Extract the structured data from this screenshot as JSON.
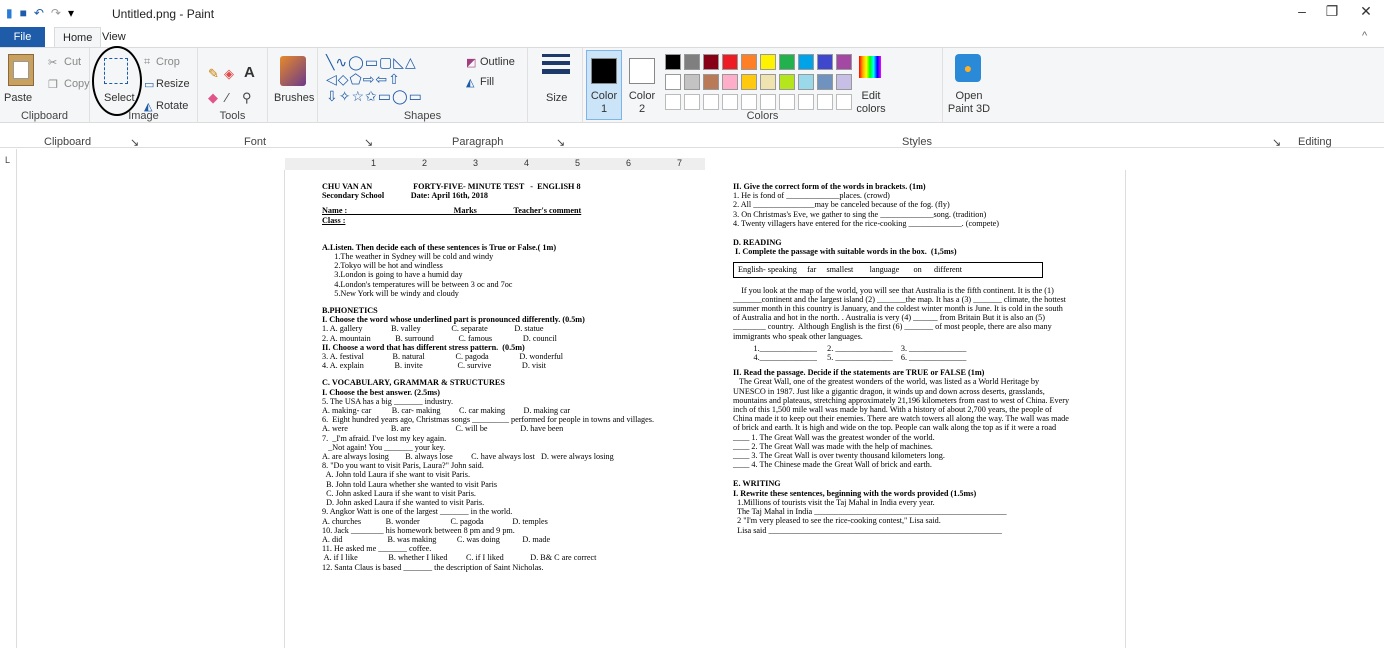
{
  "titlebar": {
    "title": "Untitled.png - Paint"
  },
  "tabs": {
    "file": "File",
    "home": "Home",
    "view": "View"
  },
  "clipboard": {
    "paste": "Paste",
    "cut": "Cut",
    "copy": "Copy",
    "label": "Clipboard"
  },
  "image": {
    "select": "Select",
    "crop": "Crop",
    "resize": "Resize",
    "rotate": "Rotate",
    "label": "Image"
  },
  "tools": {
    "label": "Tools"
  },
  "brushes": {
    "label": "Brushes"
  },
  "shapes": {
    "outline": "Outline",
    "fill": "Fill",
    "label": "Shapes"
  },
  "size": {
    "label": "Size"
  },
  "colors": {
    "color1": "Color\n1",
    "color2": "Color\n2",
    "edit": "Edit\ncolors",
    "label": "Colors",
    "palette_row1": [
      "#000000",
      "#7f7f7f",
      "#880015",
      "#ed1c24",
      "#ff7f27",
      "#fff200",
      "#22b14c",
      "#00a2e8",
      "#3f48cc",
      "#a349a4"
    ],
    "palette_row2": [
      "#ffffff",
      "#c3c3c3",
      "#b97a57",
      "#ffaec9",
      "#ffc90e",
      "#efe4b0",
      "#b5e61d",
      "#99d9ea",
      "#7092be",
      "#c8bfe7"
    ]
  },
  "paint3d": {
    "label": "Open\nPaint 3D"
  },
  "word_sections": {
    "clipboard": "Clipboard",
    "font": "Font",
    "paragraph": "Paragraph",
    "styles": "Styles",
    "editing": "Editing"
  },
  "ruler": {
    "marks": [
      "1",
      "2",
      "3",
      "4",
      "5",
      "6",
      "7"
    ]
  },
  "doc": {
    "left": [
      "CHU VAN AN                    FORTY-FIVE- MINUTE TEST   -  ENGLISH 8",
      "Secondary School             Date: April 16th, 2018",
      "Name :                                                    Marks                  Teacher's comment",
      "Class :",
      "A.Listen. Then decide each of these sentences is True or False.( 1m)",
      "      1.The weather in Sydney will be cold and windy",
      "      2.Tokyo will be hot and windless",
      "      3.London is going to have a humid day",
      "      4.London's temperatures will be between 3 oc and 7oc",
      "      5.New York will be windy and cloudy",
      "B.PHONETICS",
      "I. Choose the word whose underlined part is pronounced differently. (0.5m)",
      "1. A. gallery              B. valley               C. separate             D. statue",
      "2. A. mountain            B. surround            C. famous               D. council",
      "II. Choose a word that has different stress pattern.  (0.5m)",
      "3. A. festival              B. natural               C. pagoda               D. wonderful",
      "4. A. explain               B. invite                 C. survive               D. visit",
      "C. VOCABULARY, GRAMMAR & STRUCTURES",
      "I. Choose the best answer. (2.5ms)",
      "5. The USA has a big _______ industry.",
      "A. making- car          B. car- making         C. car making         D. making car",
      "6.  Eight hundred years ago, Christmas songs _________ performed for people in towns and villages.",
      "A. were                     B. are                      C. will be                D. have been",
      "7.  _I'm afraid. I've lost my key again.",
      "   _Not again! You _______ your key.",
      "A. are always losing        B. always lose         C. have always lost   D. were always losing",
      "8. \"Do you want to visit Paris, Laura?\" John said.",
      "  A. John told Laura if she want to visit Paris.",
      "  B. John told Laura whether she wanted to visit Paris",
      "  C. John asked Laura if she want to visit Paris.",
      "  D. John asked Laura if she wanted to visit Paris.",
      "9. Angkor Watt is one of the largest _______ in the world.",
      "A. churches            B. wonder               C. pagoda              D. temples",
      "10. Jack ________ his homework between 8 pm and 9 pm.",
      "A. did                      B. was making          C. was doing           D. made",
      "11. He asked me _______ coffee.",
      " A. if I like               B. whether I liked         C. if I liked             D. B& C are correct",
      "12. Santa Claus is based _______ the description of Saint Nicholas."
    ],
    "right": [
      "II. Give the correct form of the words in brackets. (1m)",
      "1. He is fond of _____________places. (crowd)",
      "2. All _______________may be canceled because of the fog. (fly)",
      "3. On Christmas's Eve, we gather to sing the _____________song. (tradition)",
      "4. Twenty villagers have entered for the rice-cooking _____________. (compete)",
      "D. READING",
      " I. Complete the passage with suitable words in the box.  (1,5ms)",
      "English- speaking     far     smallest        language       on      different",
      "    If you look at the map of the world, you will see that Australia is the fifth continent. It is the (1)",
      "_______continent and the largest island (2) _______the map. It has a (3) _______ climate, the hottest",
      "summer month in this country is January, and the coldest winter month is June. It is cold in the south",
      "of Australia and hot in the north. . Australia is very (4) ______ from Britain But it is also an (5)",
      "________ country.  Although English is the first (6) _______ of most people, there are also many",
      "immigrants who speak other languages.",
      "          1.______________     2. ______________    3. ______________",
      "          4.______________     5. ______________    6. ______________",
      "II. Read the passage. Decide if the statements are TRUE or FALSE (1m)",
      "   The Great Wall, one of the greatest wonders of the world, was listed as a World Heritage by",
      "UNESCO in 1987. Just like a gigantic dragon, it winds up and down across deserts, grasslands,",
      "mountains and plateaus, stretching approximately 21,196 kilometers from east to west of China. Every",
      "inch of this 1,500 mile wall was made by hand. With a history of about 2,700 years, the people of",
      "China made it to keep out their enemies. There are watch towers all along the way. The wall was made",
      "of brick and earth. It is high and wide on the top. People can walk along the top as if it were a road",
      "____ 1. The Great Wall was the greatest wonder of the world.",
      "____ 2. The Great Wall was made with the help of machines.",
      "____ 3. The Great Wall is over twenty thousand kilometers long.",
      "____ 4. The Chinese made the Great Wall of brick and earth.",
      "E. WRITING",
      "I. Rewrite these sentences, beginning with the words provided (1.5ms)",
      "  1.Millions of tourists visit the Taj Mahal in India every year.",
      "  The Taj Mahal in India _______________________________________________",
      "  2 \"I'm very pleased to see the rice-cooking contest,\" Lisa said.",
      "  Lisa said _________________________________________________________"
    ]
  }
}
